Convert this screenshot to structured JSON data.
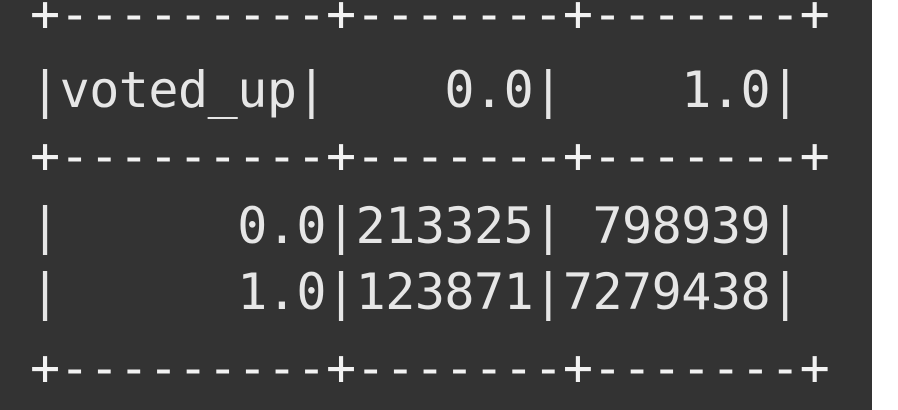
{
  "table": {
    "lines": [
      "+---------+-------+-------+",
      "|voted_up|    0.0|    1.0|",
      "+---------+-------+-------+",
      "|      0.0|213325| 798939|",
      "|      1.0|123871|7279438|",
      "+---------+-------+-------+"
    ]
  },
  "colors": {
    "background": "#333333",
    "text": "#e6e6e6"
  }
}
